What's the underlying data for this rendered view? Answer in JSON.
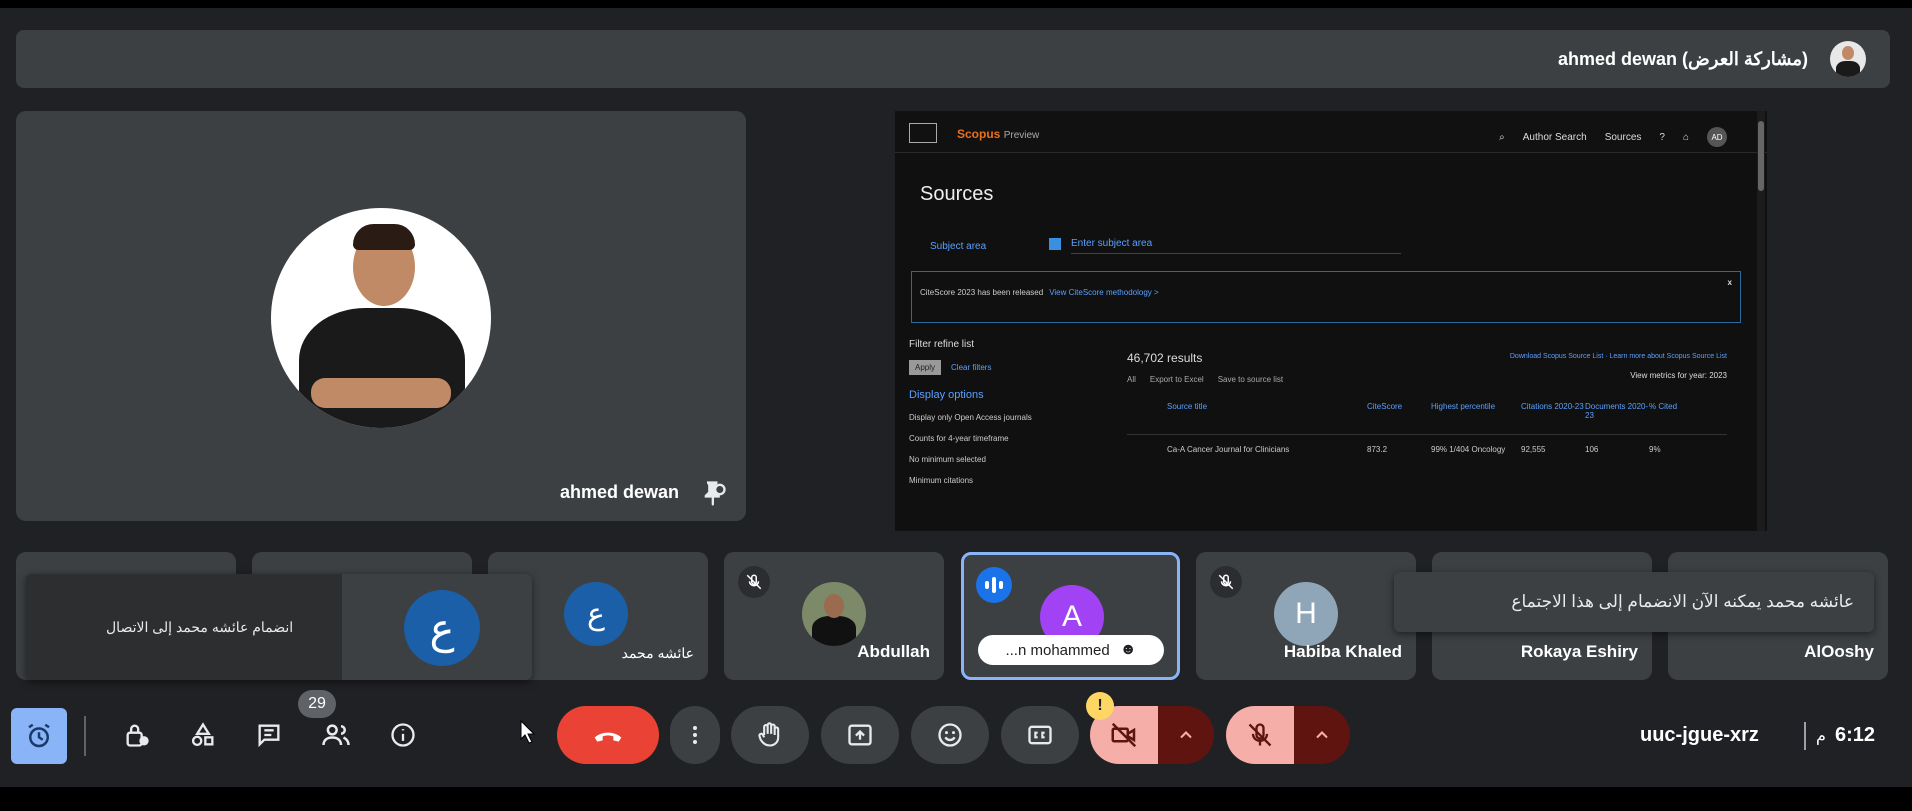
{
  "presenter_banner": {
    "text": "ahmed dewan (مشاركة العرض)"
  },
  "main_tile": {
    "name": "ahmed dewan"
  },
  "shared_screen": {
    "brand": "Scopus",
    "brand_suffix": "Preview",
    "nav": [
      "Author Search",
      "Sources"
    ],
    "account_initials": "AD",
    "page_title": "Sources",
    "subject_label": "Subject area",
    "subject_placeholder": "Enter subject area",
    "notice_text": "CiteScore 2023 has been released",
    "notice_link": "View CiteScore methodology >",
    "notice_close": "x",
    "filter_heading": "Filter refine list",
    "apply": "Apply",
    "clear": "Clear filters",
    "display_options": "Display options",
    "open_access": "Display only Open Access journals",
    "counts_label": "Counts for 4-year timeframe",
    "no_minimum": "No minimum selected",
    "min_citations": "Minimum citations",
    "results_count": "46,702 results",
    "download_link": "Download Scopus Source List  ·  Learn more about Scopus Source List",
    "tool_all": "All",
    "tool_export": "Export to Excel",
    "tool_save": "Save to source list",
    "metrics_label": "View metrics for year:",
    "metrics_year": "2023",
    "columns": [
      "Source title",
      "CiteScore",
      "Highest percentile",
      "Citations 2020-23",
      "Documents 2020-23",
      "% Cited"
    ],
    "row": [
      "Ca-A Cancer Journal for Clinicians",
      "873.2",
      "99% 1/404 Oncology",
      "92,555",
      "106",
      "9%"
    ]
  },
  "participants": [
    {
      "name": "عائشه محمد",
      "initial": "ع",
      "color": "#1a5fa8"
    },
    {
      "name": "Abdullah"
    },
    {
      "name": "...n mohammed",
      "initial": "A",
      "color": "#a142f4"
    },
    {
      "name": "Habiba Khaled",
      "initial": "H",
      "color": "#8fa5b8"
    },
    {
      "name": "Rokaya Eshiry"
    },
    {
      "name": "AlOoshy"
    }
  ],
  "toast_join": {
    "text": "انضمام عائشه محمد إلى الاتصال",
    "initial": "ع"
  },
  "toast_message": {
    "text": "عائشه محمد يمكنه الآن الانضمام إلى هذا الاجتماع"
  },
  "controls": {
    "participants_count": "29",
    "warning_badge": "!",
    "meeting_code": "uuc-jgue-xrz",
    "time": "6:12",
    "ampm": "م"
  },
  "colors": {
    "leave": "#ea4335",
    "active_border": "#8ab4f8",
    "muted": "#f6aea9"
  }
}
